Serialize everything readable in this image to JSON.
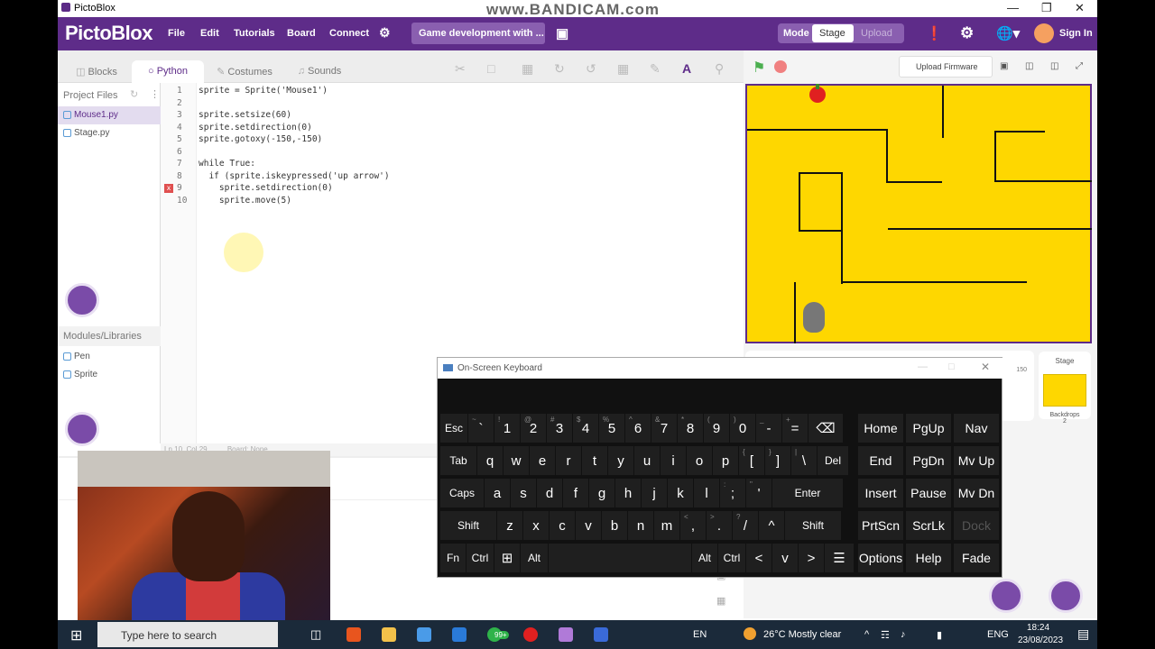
{
  "window": {
    "title": "PictoBlox",
    "watermark": "www.BANDICAM.com"
  },
  "menubar": {
    "logo": "PictoBlox",
    "items": [
      "File",
      "Edit",
      "Tutorials",
      "Board",
      "Connect"
    ],
    "project_name": "Game development with ...",
    "mode_label": "Mode",
    "stage_label": "Stage",
    "upload_label": "Upload",
    "signin_label": "Sign In"
  },
  "tabs": [
    "Blocks",
    "Python",
    "Costumes",
    "Sounds"
  ],
  "active_tab": "Python",
  "right_toolbar": {
    "upload_firmware": "Upload Firmware"
  },
  "sidebar": {
    "project_files_label": "Project Files",
    "files": [
      "Mouse1.py",
      "Stage.py"
    ],
    "modules_label": "Modules/Libraries",
    "modules": [
      "Pen",
      "Sprite"
    ]
  },
  "editor": {
    "lines": [
      {
        "n": "1",
        "text": "sprite = Sprite('Mouse1')"
      },
      {
        "n": "2",
        "text": ""
      },
      {
        "n": "3",
        "text": "sprite.setsize(60)"
      },
      {
        "n": "4",
        "text": "sprite.setdirection(0)"
      },
      {
        "n": "5",
        "text": "sprite.gotoxy(-150,-150)"
      },
      {
        "n": "6",
        "text": ""
      },
      {
        "n": "7",
        "text": "while True:"
      },
      {
        "n": "8",
        "text": "  if (sprite.iskeypressed('up arrow')"
      },
      {
        "n": "9",
        "text": "    sprite.setdirection(0)"
      },
      {
        "n": "10",
        "text": "    sprite.move(5)"
      }
    ],
    "status": "Ln 10, Col 29",
    "board": "Board: None"
  },
  "sprite_panel": {
    "stage_label": "Stage",
    "backdrops_label": "Backdrops",
    "backdrops_count": "2",
    "partial_value": "150"
  },
  "osk": {
    "title": "On-Screen Keyboard",
    "rows": [
      [
        [
          "Esc",
          ""
        ],
        [
          "`",
          "~"
        ],
        [
          "1",
          "!"
        ],
        [
          "2",
          "@"
        ],
        [
          "3",
          "#"
        ],
        [
          "4",
          "$"
        ],
        [
          "5",
          "%"
        ],
        [
          "6",
          "^"
        ],
        [
          "7",
          "&"
        ],
        [
          "8",
          "*"
        ],
        [
          "9",
          "("
        ],
        [
          "0",
          ")"
        ],
        [
          "-",
          "_"
        ],
        [
          "=",
          "+"
        ],
        [
          "⌫",
          ""
        ]
      ],
      [
        [
          "Tab",
          ""
        ],
        [
          "q",
          ""
        ],
        [
          "w",
          ""
        ],
        [
          "e",
          ""
        ],
        [
          "r",
          ""
        ],
        [
          "t",
          ""
        ],
        [
          "y",
          ""
        ],
        [
          "u",
          ""
        ],
        [
          "i",
          ""
        ],
        [
          "o",
          ""
        ],
        [
          "p",
          ""
        ],
        [
          "[",
          "{"
        ],
        [
          "]",
          "}"
        ],
        [
          "\\",
          "|"
        ],
        [
          "Del",
          ""
        ]
      ],
      [
        [
          "Caps",
          ""
        ],
        [
          "a",
          ""
        ],
        [
          "s",
          ""
        ],
        [
          "d",
          ""
        ],
        [
          "f",
          ""
        ],
        [
          "g",
          ""
        ],
        [
          "h",
          ""
        ],
        [
          "j",
          ""
        ],
        [
          "k",
          ""
        ],
        [
          "l",
          ""
        ],
        [
          ";",
          ":"
        ],
        [
          "'",
          "\""
        ],
        [
          "Enter",
          ""
        ]
      ],
      [
        [
          "Shift",
          ""
        ],
        [
          "z",
          ""
        ],
        [
          "x",
          ""
        ],
        [
          "c",
          ""
        ],
        [
          "v",
          ""
        ],
        [
          "b",
          ""
        ],
        [
          "n",
          ""
        ],
        [
          "m",
          ""
        ],
        [
          ",",
          "<"
        ],
        [
          ".",
          ">"
        ],
        [
          "/",
          "?"
        ],
        [
          "^",
          ""
        ],
        [
          "Shift",
          ""
        ]
      ],
      [
        [
          "Fn",
          ""
        ],
        [
          "Ctrl",
          ""
        ],
        [
          "⊞",
          ""
        ],
        [
          "Alt",
          ""
        ],
        [
          "",
          ""
        ],
        [
          "Alt",
          ""
        ],
        [
          "Ctrl",
          ""
        ],
        [
          "<",
          ""
        ],
        [
          "v",
          ""
        ],
        [
          ">",
          ""
        ],
        [
          "☰",
          ""
        ]
      ]
    ],
    "nav": [
      [
        "Home",
        "PgUp",
        "Nav"
      ],
      [
        "End",
        "PgDn",
        "Mv Up"
      ],
      [
        "Insert",
        "Pause",
        "Mv Dn"
      ],
      [
        "PrtScn",
        "ScrLk",
        "Dock"
      ],
      [
        "Options",
        "Help",
        "Fade"
      ]
    ]
  },
  "taskbar": {
    "search_placeholder": "Type here to search",
    "lang": "EN",
    "weather": "26°C  Mostly clear",
    "lang2": "ENG",
    "time": "18:24",
    "date": "23/08/2023",
    "badge": "99+"
  }
}
